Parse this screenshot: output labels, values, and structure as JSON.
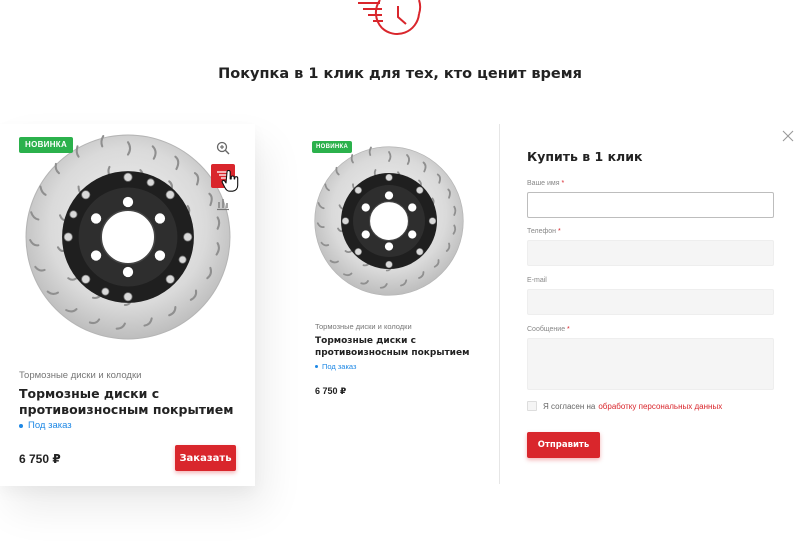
{
  "header": {
    "icon": "fast-order-clock-icon",
    "headline": "Покупка в 1 клик для тех, кто ценит время"
  },
  "product_card": {
    "badge": "НОВИНКА",
    "category": "Тормозные диски и колодки",
    "title": "Тормозные диски с противоизносным покрытием",
    "availability": "Под заказ",
    "price": "6 750 ₽",
    "order_button": "Заказать",
    "tools": [
      "zoom-icon",
      "one-click-cart-icon",
      "compare-icon"
    ]
  },
  "preview": {
    "badge": "НОВИНКА",
    "category": "Тормозные диски и колодки",
    "title": "Тормозные диски с противоизносным покрытием",
    "availability": "Под заказ",
    "price": "6 750 ₽"
  },
  "form": {
    "title": "Купить в 1 клик",
    "fields": {
      "name": {
        "label": "Ваше имя",
        "required": "*"
      },
      "phone": {
        "label": "Телефон",
        "required": "*"
      },
      "email": {
        "label": "E-mail"
      },
      "message": {
        "label": "Сообщение",
        "required": "*"
      }
    },
    "consent_text": "Я согласен на",
    "consent_link": "обработку персональных данных",
    "submit": "Отправить"
  },
  "colors": {
    "accent": "#d9262c",
    "badge": "#2bb14c",
    "availability": "#1e88e5"
  }
}
